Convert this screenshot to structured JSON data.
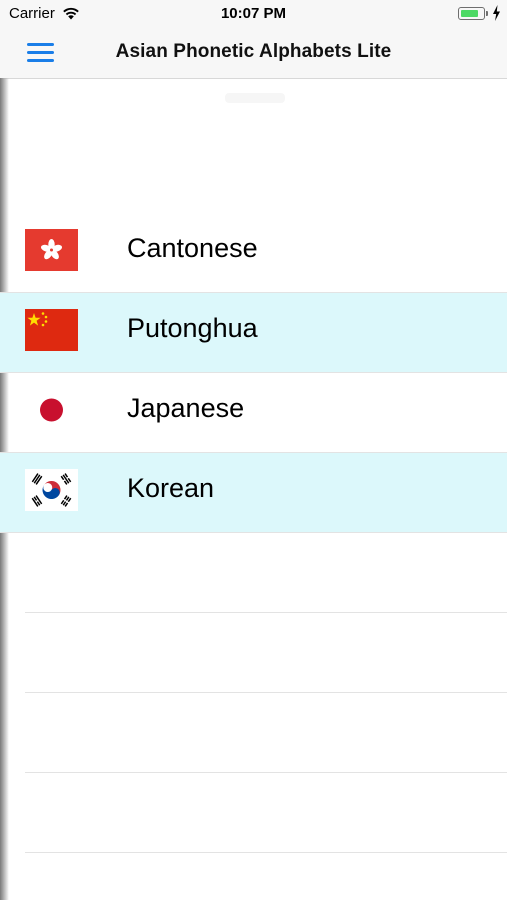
{
  "status_bar": {
    "carrier": "Carrier",
    "time": "10:07 PM",
    "wifi_icon": "wifi-icon",
    "battery_icon": "battery-icon",
    "battery_level": 0.85,
    "battery_color": "#4cd964"
  },
  "nav": {
    "title": "Asian Phonetic Alphabets Lite",
    "menu_icon": "hamburger-menu-icon",
    "accent_color": "#1a7ee8"
  },
  "languages": [
    {
      "label": "Cantonese",
      "flag": "hong-kong-flag-icon"
    },
    {
      "label": "Putonghua",
      "flag": "china-flag-icon"
    },
    {
      "label": "Japanese",
      "flag": "japan-flag-icon"
    },
    {
      "label": "Korean",
      "flag": "south-korea-flag-icon"
    }
  ],
  "row_highlight_color": "#dcf8fb"
}
